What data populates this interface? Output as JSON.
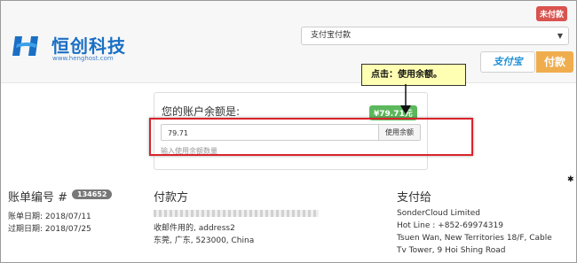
{
  "header": {
    "logo_name": "恒创科技",
    "logo_url": "www.henghost.com",
    "logo_icon": "hengchuang-logo-icon",
    "status_badge": "未付款",
    "gateway_select": "支付宝付款",
    "alipay_label": "支付宝",
    "pay_button": "付款"
  },
  "tooltip": {
    "text": "点击：使用余额。"
  },
  "credit": {
    "title": "您的账户余额是:",
    "balance": "¥79.71元",
    "amount_value": "79.71",
    "apply_button": "使用余额",
    "hint": "输入使用余额数量"
  },
  "invoice": {
    "label": "账单编号 #",
    "number": "134652",
    "date": "账单日期: 2018/07/11",
    "due": "过期日期: 2018/07/25"
  },
  "pay_to_from": {
    "from_title": "付款方",
    "from_lines": [
      "收邮件用的, address2",
      "东莞, 广东, 523000, China"
    ],
    "to_title": "支付给",
    "to_lines": [
      "SonderCloud Limited",
      "Hot Line : +852-69974319",
      "Tsuen Wan, New Territories 18/F, Cable",
      "Tv Tower, 9 Hoi Shing Road"
    ]
  },
  "colors": {
    "brand": "#1a6fc4",
    "unpaid_red": "#d9534f",
    "pay_orange": "#f0ad4e",
    "credit_green": "#5cb85c",
    "highlight_red": "#d9242b",
    "tooltip_yellow": "#ffffb3"
  }
}
